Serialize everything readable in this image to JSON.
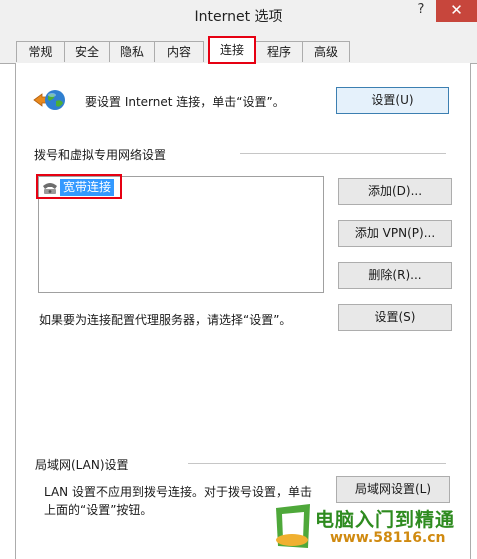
{
  "window": {
    "title": "Internet 选项",
    "help_label": "?",
    "close_label": "✕"
  },
  "tabs": [
    "常规",
    "安全",
    "隐私",
    "内容",
    "连接",
    "程序",
    "高级"
  ],
  "active_tab": "连接",
  "setup": {
    "text": "要设置 Internet 连接，单击“设置”。",
    "button": "设置(U)"
  },
  "dialup": {
    "heading": "拨号和虚拟专用网络设置",
    "items": [
      "宽带连接"
    ],
    "buttons": {
      "add": "添加(D)...",
      "add_vpn": "添加 VPN(P)...",
      "remove": "删除(R)..."
    },
    "proxy_text": "如果要为连接配置代理服务器，请选择“设置”。",
    "settings_button": "设置(S)"
  },
  "lan": {
    "heading": "局域网(LAN)设置",
    "text_line1": "LAN 设置不应用到拨号连接。对于拨号设置，单击",
    "text_line2": "上面的“设置”按钮。",
    "button": "局域网设置(L)"
  },
  "watermark": {
    "text": "电脑入门到精通",
    "url": "www.58116.cn"
  },
  "colors": {
    "accent": "#3399ff",
    "highlight": "#e60012",
    "close": "#c7463c",
    "watermark_green": "#2e8b1f",
    "watermark_orange": "#d08a10"
  }
}
